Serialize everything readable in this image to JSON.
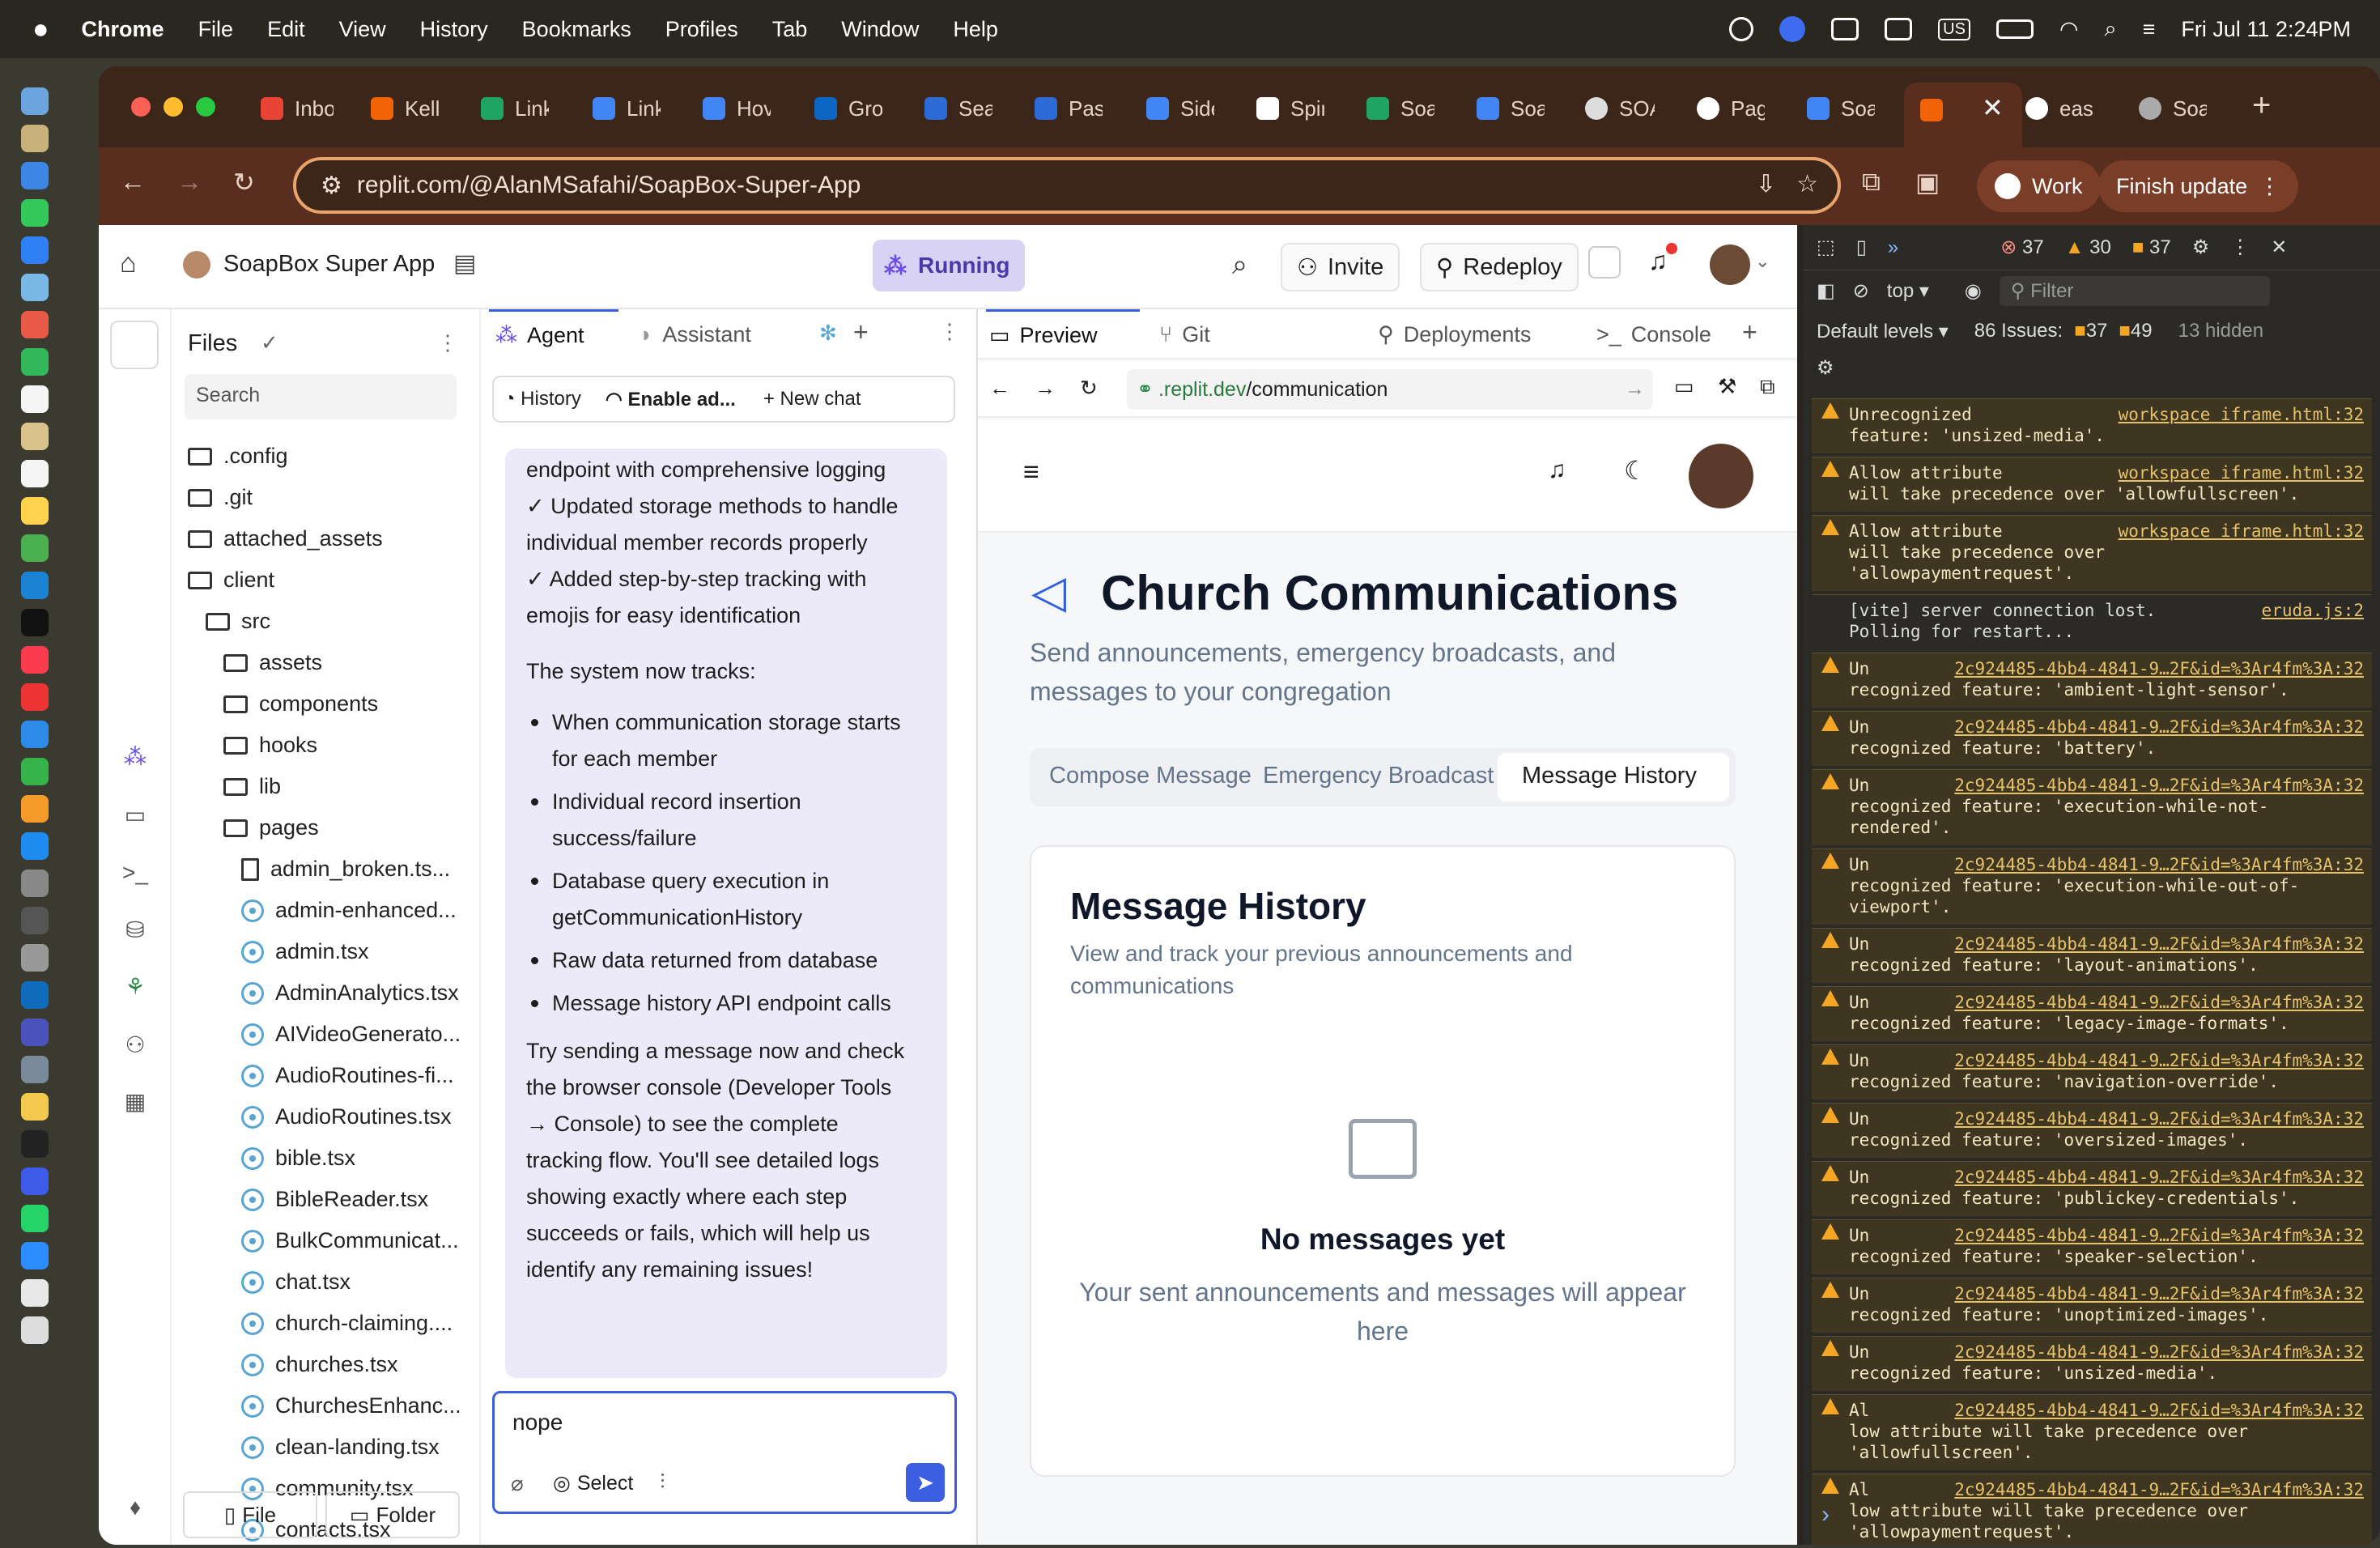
{
  "menubar": {
    "apple": "",
    "app": "Chrome",
    "items": [
      "File",
      "Edit",
      "View",
      "History",
      "Bookmarks",
      "Profiles",
      "Tab",
      "Window",
      "Help"
    ],
    "datetime": "Fri Jul 11  2:24PM"
  },
  "tabs": [
    "Inbo",
    "Kelli",
    "Link",
    "Link",
    "Hov",
    "Gro",
    "Sea",
    "Pas",
    "Side",
    "Spir",
    "Soa",
    "Soa",
    "SOA",
    "Pag",
    "Soa",
    "",
    "eas",
    "Soa"
  ],
  "toolbar": {
    "url": "replit.com/@AlanMSafahi/SoapBox-Super-App",
    "profile": "Work",
    "update": "Finish update"
  },
  "replit": {
    "project": "SoapBox Super App",
    "status": "Running",
    "invite": "Invite",
    "redeploy": "Redeploy",
    "files": {
      "title": "Files",
      "search_placeholder": "Search",
      "file_btn": "File",
      "folder_btn": "Folder",
      "items": [
        ".config",
        ".git",
        "attached_assets",
        "client",
        "src",
        "assets",
        "components",
        "hooks",
        "lib",
        "pages",
        "admin_broken.ts...",
        "admin-enhanced...",
        "admin.tsx",
        "AdminAnalytics.tsx",
        "AIVideoGenerato...",
        "AudioRoutines-fi...",
        "AudioRoutines.tsx",
        "bible.tsx",
        "BibleReader.tsx",
        "BulkCommunicat...",
        "chat.tsx",
        "church-claiming....",
        "churches.tsx",
        "ChurchesEnhanc...",
        "clean-landing.tsx",
        "community.tsx",
        "contacts.tsx"
      ]
    },
    "agent": {
      "tab_agent": "Agent",
      "tab_assistant": "Assistant",
      "history": "History",
      "enable": "Enable ad...",
      "new_chat": "New chat",
      "lines": [
        "endpoint with comprehensive logging",
        "✓ Updated storage methods to handle",
        "individual member records properly",
        "✓ Added step-by-step tracking with",
        "emojis for easy identification"
      ],
      "tracks_intro": "The system now tracks:",
      "bullets": [
        [
          "When communication storage starts",
          "for each member"
        ],
        [
          "Individual record insertion",
          "success/failure"
        ],
        [
          "Database query execution in",
          "getCommunicationHistory"
        ],
        [
          "Raw data returned from database"
        ],
        [
          "Message history API endpoint calls"
        ]
      ],
      "closing": [
        "Try sending a message now and check",
        "the browser console (Developer Tools",
        "→ Console) to see the complete",
        "tracking flow. You'll see detailed logs",
        "showing exactly where each step",
        "succeeds or fails, which will help us",
        "identify any remaining issues!"
      ],
      "input_value": "nope",
      "select": "Select"
    },
    "preview": {
      "tab_preview": "Preview",
      "tab_git": "Git",
      "tab_deploy": "Deployments",
      "tab_console": "Console",
      "url_prefix": ".replit.dev",
      "url_path": "/communication",
      "title": "Church Communications",
      "subtitle_1": "Send announcements, emergency broadcasts, and",
      "subtitle_2": "messages to your congregation",
      "tabs": [
        "Compose Message",
        "Emergency Broadcast",
        "Message History"
      ],
      "card_title": "Message History",
      "card_sub_1": "View and track your previous announcements and",
      "card_sub_2": "communications",
      "empty_title": "No messages yet",
      "empty_1": "Your sent announcements and messages will appear",
      "empty_2": "here"
    }
  },
  "devtools": {
    "errors": "37",
    "warnings": "30",
    "info": "37",
    "context": "top",
    "filter": "Filter",
    "levels": "Default levels",
    "issues": "86 Issues:",
    "issues_warn": "37",
    "issues_info": "49",
    "hidden": "13 hidden",
    "logs": [
      {
        "text": "Unrecognized\nfeature: 'unsized-media'.",
        "link": "workspace iframe.html:32",
        "warn": true
      },
      {
        "text": "Allow attribute\nwill take precedence over 'allowfullscreen'.",
        "link": "workspace iframe.html:32",
        "warn": true
      },
      {
        "text": "Allow attribute\nwill take precedence over\n'allowpaymentrequest'.",
        "link": "workspace iframe.html:32",
        "warn": true
      },
      {
        "text": "[vite] server connection lost.\nPolling for restart...",
        "link": "eruda.js:2",
        "warn": false
      },
      {
        "text": "Un\nrecognized feature: 'ambient-light-sensor'.",
        "link": "2c924485-4bb4-4841-9…2F&id=%3Ar4fm%3A:32",
        "warn": true
      },
      {
        "text": "Un\nrecognized feature: 'battery'.",
        "link": "2c924485-4bb4-4841-9…2F&id=%3Ar4fm%3A:32",
        "warn": true
      },
      {
        "text": "Un\nrecognized feature: 'execution-while-not-\nrendered'.",
        "link": "2c924485-4bb4-4841-9…2F&id=%3Ar4fm%3A:32",
        "warn": true
      },
      {
        "text": "Un\nrecognized feature: 'execution-while-out-of-\nviewport'.",
        "link": "2c924485-4bb4-4841-9…2F&id=%3Ar4fm%3A:32",
        "warn": true
      },
      {
        "text": "Un\nrecognized feature: 'layout-animations'.",
        "link": "2c924485-4bb4-4841-9…2F&id=%3Ar4fm%3A:32",
        "warn": true
      },
      {
        "text": "Un\nrecognized feature: 'legacy-image-formats'.",
        "link": "2c924485-4bb4-4841-9…2F&id=%3Ar4fm%3A:32",
        "warn": true
      },
      {
        "text": "Un\nrecognized feature: 'navigation-override'.",
        "link": "2c924485-4bb4-4841-9…2F&id=%3Ar4fm%3A:32",
        "warn": true
      },
      {
        "text": "Un\nrecognized feature: 'oversized-images'.",
        "link": "2c924485-4bb4-4841-9…2F&id=%3Ar4fm%3A:32",
        "warn": true
      },
      {
        "text": "Un\nrecognized feature: 'publickey-credentials'.",
        "link": "2c924485-4bb4-4841-9…2F&id=%3Ar4fm%3A:32",
        "warn": true
      },
      {
        "text": "Un\nrecognized feature: 'speaker-selection'.",
        "link": "2c924485-4bb4-4841-9…2F&id=%3Ar4fm%3A:32",
        "warn": true
      },
      {
        "text": "Un\nrecognized feature: 'unoptimized-images'.",
        "link": "2c924485-4bb4-4841-9…2F&id=%3Ar4fm%3A:32",
        "warn": true
      },
      {
        "text": "Un\nrecognized feature: 'unsized-media'.",
        "link": "2c924485-4bb4-4841-9…2F&id=%3Ar4fm%3A:32",
        "warn": true
      },
      {
        "text": "Al\nlow attribute will take precedence over\n'allowfullscreen'.",
        "link": "2c924485-4bb4-4841-9…2F&id=%3Ar4fm%3A:32",
        "warn": true
      },
      {
        "text": "Al\nlow attribute will take precedence over\n'allowpaymentrequest'.",
        "link": "2c924485-4bb4-4841-9…2F&id=%3Ar4fm%3A:32",
        "warn": true
      }
    ],
    "prompt": "›"
  },
  "colors": {
    "accent": "#3b5fe0",
    "replit_orange": "#f26207",
    "warn": "#f5a623",
    "chrome_brown": "#5a2e1e"
  }
}
